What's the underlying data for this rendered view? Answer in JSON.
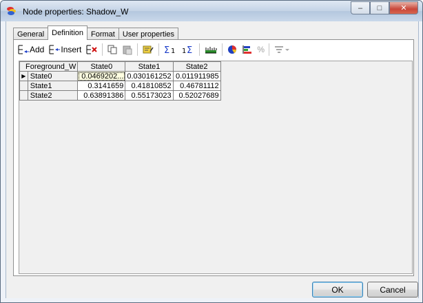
{
  "window": {
    "title": "Node properties: Shadow_W",
    "min_label": "–",
    "max_label": "□",
    "close_label": "✕"
  },
  "tabs": [
    {
      "label": "General"
    },
    {
      "label": "Definition"
    },
    {
      "label": "Format"
    },
    {
      "label": "User properties"
    }
  ],
  "toolbar": {
    "add_label": "Add",
    "insert_label": "Insert",
    "percent_label": "%"
  },
  "table": {
    "corner": "Foreground_W",
    "columns": [
      "State0",
      "State1",
      "State2"
    ],
    "rows": [
      {
        "label": "State0",
        "values": [
          "0.0469202...",
          "0.030161252",
          "0.011911985"
        ]
      },
      {
        "label": "State1",
        "values": [
          "0.3141659",
          "0.41810852",
          "0.46781112"
        ]
      },
      {
        "label": "State2",
        "values": [
          "0.63891386",
          "0.55173023",
          "0.52027689"
        ]
      }
    ]
  },
  "buttons": {
    "ok": "OK",
    "cancel": "Cancel"
  }
}
